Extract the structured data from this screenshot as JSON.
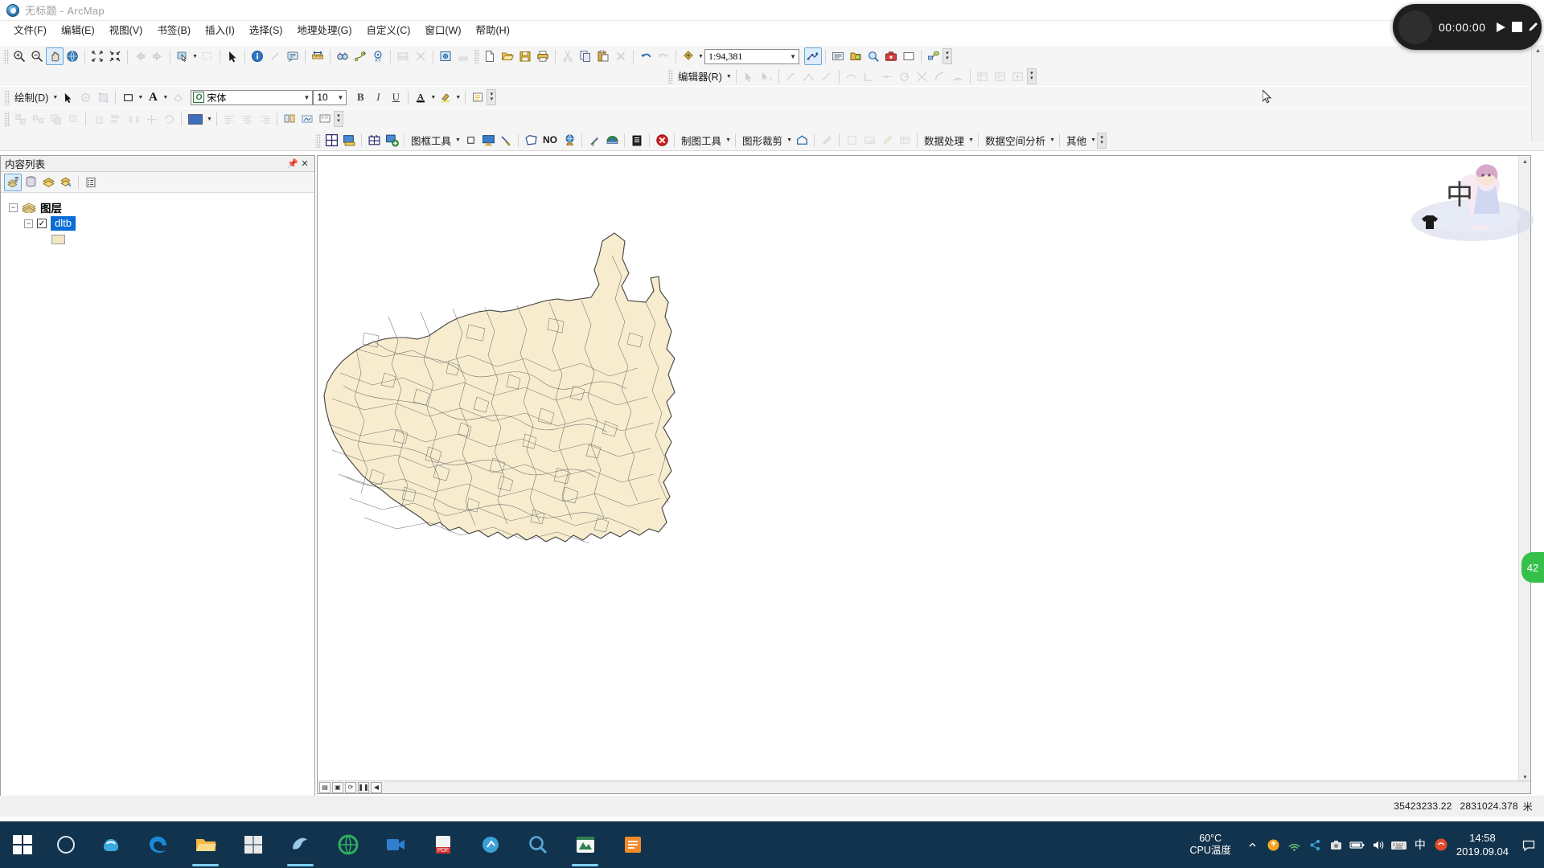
{
  "window": {
    "title": "无标题 - ArcMap",
    "app_icon": "arcmap-globe-icon",
    "minimize": "—",
    "maximize": "▢",
    "close": "✕"
  },
  "menubar": {
    "items": [
      {
        "label": "文件(F)",
        "name": "menu-file"
      },
      {
        "label": "编辑(E)",
        "name": "menu-edit"
      },
      {
        "label": "视图(V)",
        "name": "menu-view"
      },
      {
        "label": "书签(B)",
        "name": "menu-bookmarks"
      },
      {
        "label": "插入(I)",
        "name": "menu-insert"
      },
      {
        "label": "选择(S)",
        "name": "menu-selection"
      },
      {
        "label": "地理处理(G)",
        "name": "menu-geoprocessing"
      },
      {
        "label": "自定义(C)",
        "name": "menu-customize"
      },
      {
        "label": "窗口(W)",
        "name": "menu-window"
      },
      {
        "label": "帮助(H)",
        "name": "menu-help"
      }
    ]
  },
  "tools_toolbar": {
    "icons": [
      "zoom-in-icon",
      "zoom-out-icon",
      "pan-icon",
      "full-extent-icon",
      "fixed-zoom-in-icon",
      "fixed-zoom-out-icon",
      "back-extent-icon",
      "forward-extent-icon",
      "select-features-icon",
      "clear-selection-icon",
      "select-elements-icon",
      "identify-icon",
      "hyperlink-icon",
      "html-popup-icon",
      "measure-icon",
      "find-icon",
      "find-route-icon",
      "go-to-xy-icon",
      "time-slider-icon",
      "create-viewer-window-icon"
    ]
  },
  "standard_toolbar": {
    "scale_value": "1:94,381",
    "scale_name": "map-scale-combo",
    "icons": [
      "new-map-icon",
      "open-icon",
      "save-icon",
      "print-icon",
      "cut-icon",
      "copy-icon",
      "paste-icon",
      "delete-icon",
      "undo-icon",
      "redo-icon",
      "add-data-icon",
      "editor-toolbar-icon",
      "table-of-contents-icon",
      "catalog-icon",
      "search-icon",
      "arctoolbox-icon",
      "python-window-icon",
      "modelbuilder-icon"
    ]
  },
  "editor_toolbar": {
    "label": "编辑器(R)",
    "name": "editor-menu",
    "icons": [
      "edit-tool-icon",
      "edit-annotation-icon",
      "straight-segment-icon",
      "construct-points-icon",
      "curve-segment-icon",
      "end-point-arc-icon",
      "trace-icon",
      "right-angle-icon",
      "midpoint-icon",
      "distance-icon",
      "intersection-icon",
      "arc-icon",
      "tangent-icon",
      "attributes-icon",
      "sketch-properties-icon",
      "create-features-icon"
    ]
  },
  "draw_toolbar": {
    "label": "绘制(D)",
    "font_family_value": "宋体",
    "font_size_value": "10",
    "bold": "B",
    "italic": "I",
    "underline": "U",
    "font_color": "A",
    "highlight": "highlight-icon",
    "icons": [
      "select-elements-icon",
      "rotate-icon",
      "edit-vertices-icon",
      "fill-color-icon",
      "text-tool-icon",
      "new-rectangle-icon"
    ]
  },
  "draw_toolbar2": {
    "fill_color": "#3a6fbf",
    "icons": [
      "group-icon",
      "ungroup-icon",
      "order-icon",
      "bring-forward-icon",
      "send-backward-icon",
      "align-icon",
      "distribute-icon",
      "nudge-icon",
      "rotate-or-flip-icon",
      "fill-color-picker-icon",
      "align-left-icon",
      "align-center-icon",
      "align-right-icon",
      "convert-to-graphics-icon"
    ]
  },
  "custom_toolbar": {
    "groups": [
      {
        "label": "图框工具",
        "name": "frame-tools-menu"
      },
      {
        "label": "制图工具",
        "name": "mapping-tools-menu"
      },
      {
        "label": "图形裁剪",
        "name": "graphic-clip-menu"
      },
      {
        "label": "数据处理",
        "name": "data-processing-menu"
      },
      {
        "label": "数据空间分析",
        "name": "spatial-analysis-menu"
      },
      {
        "label": "其他",
        "name": "other-menu"
      }
    ],
    "no_label": "NO",
    "icons": [
      "grid-icon",
      "map-display-icon",
      "grid-split-icon",
      "add-map-icon",
      "square-icon",
      "monitor-icon",
      "pick-icon",
      "polygon-icon",
      "globe-icon",
      "list-icon",
      "cancel-icon",
      "house-icon",
      "brush-icon",
      "shape-icon",
      "image-icon",
      "pencil-icon",
      "table-icon"
    ]
  },
  "toc": {
    "header_title": "内容列表",
    "pin_icon": "pin-icon",
    "close_icon": "close-icon",
    "toolbar_icons": [
      "list-by-drawing-order-icon",
      "list-by-source-icon",
      "list-by-visibility-icon",
      "list-by-selection-icon",
      "options-icon"
    ],
    "tree": {
      "root_label": "图层",
      "root_icon": "layers-icon",
      "layer_label": "dltb",
      "layer_checked": "✓",
      "symbol_color": "#f5e9c8"
    }
  },
  "map": {
    "layer_fill": "#f7ecce",
    "layer_outline": "#6e6e6e",
    "bottom_bar_icons": [
      "data-view-icon",
      "layout-view-icon",
      "refresh-icon",
      "pause-drawing-icon",
      "prev-page-icon"
    ]
  },
  "statusbar": {
    "coordinate_x": "35423233.22",
    "coordinate_y": "2831024.378",
    "units": "米"
  },
  "recorder": {
    "elapsed": "00:00:00",
    "play_icon": "play-icon",
    "stop_icon": "stop-icon",
    "edit_icon": "pencil-icon"
  },
  "widgets": {
    "green_badge": "42"
  },
  "taskbar": {
    "start_icon": "windows-start-icon",
    "cortana_icon": "cortana-search-icon",
    "apps": [
      {
        "name": "taskbar-app-sogou",
        "icon": "sogou-icon",
        "color": "#3da8dd",
        "underline": "#00000000"
      },
      {
        "name": "taskbar-app-edge",
        "icon": "edge-icon",
        "color": "#1b8ad6",
        "underline": "#00000000"
      },
      {
        "name": "taskbar-app-explorer",
        "icon": "file-explorer-icon",
        "color": "#f5b945",
        "underline": "#7fd2f5"
      },
      {
        "name": "taskbar-app-store",
        "icon": "microsoft-store-icon",
        "color": "#e9e9e9",
        "underline": "#00000000"
      },
      {
        "name": "taskbar-app-office",
        "icon": "office-icon",
        "color": "#9bc8e8",
        "underline": "#7fd2f5"
      },
      {
        "name": "taskbar-app-browser",
        "icon": "browser-icon",
        "color": "#2fae5d",
        "underline": "#00000000"
      },
      {
        "name": "taskbar-app-meeting",
        "icon": "meeting-icon",
        "color": "#2f7fd0",
        "underline": "#00000000"
      },
      {
        "name": "taskbar-app-pdf",
        "icon": "pdf-reader-icon",
        "color": "#d32f2f",
        "underline": "#00000000"
      },
      {
        "name": "taskbar-app-tool",
        "icon": "tool-icon",
        "color": "#3aa0d8",
        "underline": "#00000000"
      },
      {
        "name": "taskbar-app-magnifier",
        "icon": "magnifier-icon",
        "color": "#58a8d8",
        "underline": "#00000000"
      },
      {
        "name": "taskbar-app-arcmap",
        "icon": "arcmap-icon",
        "color": "#2f7f4f",
        "underline": "#7fd2f5"
      },
      {
        "name": "taskbar-app-notes",
        "icon": "notes-icon",
        "color": "#ef8b2a",
        "underline": "#00000000"
      }
    ],
    "cpu_temp_value": "60°C",
    "cpu_temp_label": "CPU温度",
    "tray_icons": [
      "show-hidden-icons",
      "update-icon",
      "network-icon",
      "share-icon",
      "screenshot-icon",
      "battery-icon",
      "volume-icon",
      "keyboard-icon"
    ],
    "ime_label": "中",
    "ime_tool": "sogou-ime-icon",
    "time": "14:58",
    "date": "2019.09.04",
    "notification_icon": "action-center-icon"
  }
}
